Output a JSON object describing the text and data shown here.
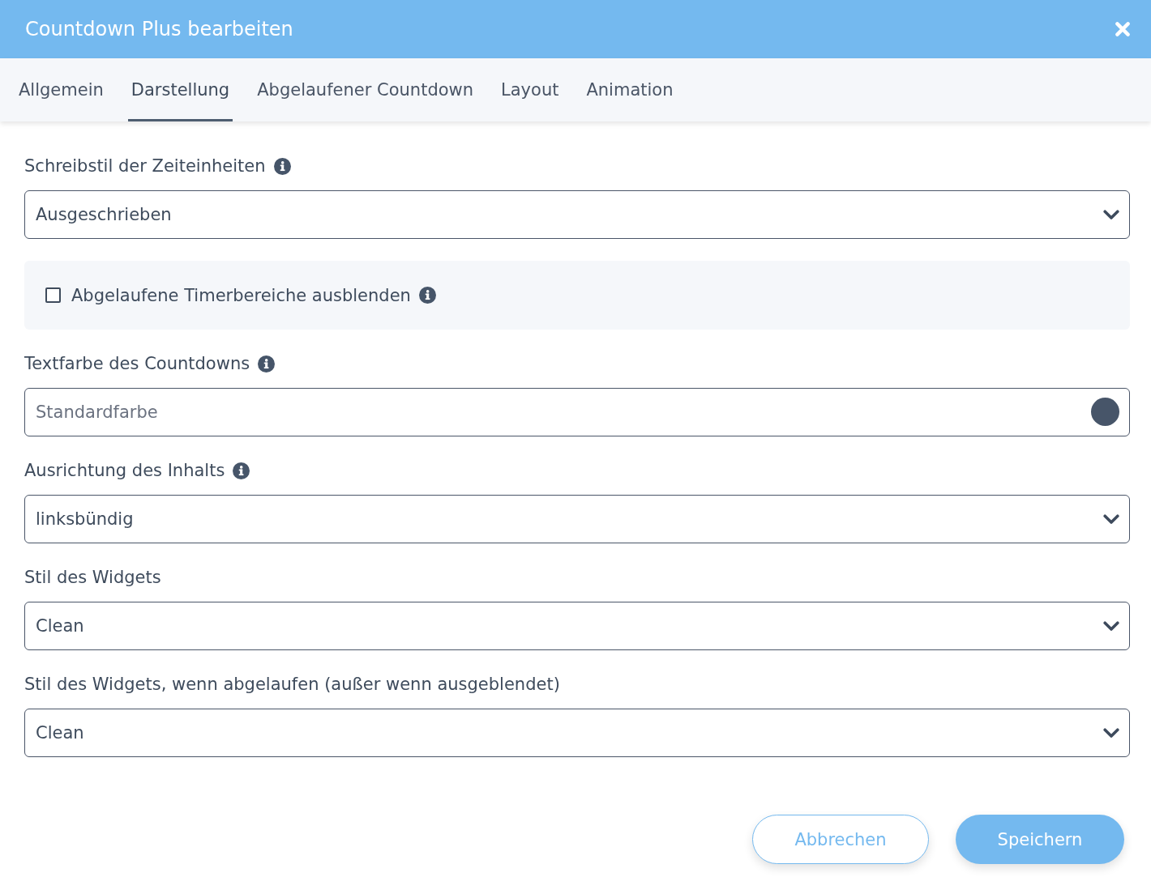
{
  "dialog": {
    "title": "Countdown Plus bearbeiten"
  },
  "tabs": [
    {
      "label": "Allgemein",
      "selected": false
    },
    {
      "label": "Darstellung",
      "selected": true
    },
    {
      "label": "Abgelaufener Countdown",
      "selected": false
    },
    {
      "label": "Layout",
      "selected": false
    },
    {
      "label": "Animation",
      "selected": false
    }
  ],
  "fields": [
    {
      "kind": "select",
      "label": "Schreibstil der Zeiteinheiten",
      "info": true,
      "value": "Ausgeschrieben"
    },
    {
      "kind": "checkbox",
      "label": "Abgelaufene Timerbereiche ausblenden",
      "info": true,
      "checked": false
    },
    {
      "kind": "color",
      "label": "Textfarbe des Countdowns",
      "info": true,
      "placeholder": "Standardfarbe",
      "color": "#475569"
    },
    {
      "kind": "select",
      "label": "Ausrichtung des Inhalts",
      "info": true,
      "value": "linksbündig"
    },
    {
      "kind": "select",
      "label": "Stil des Widgets",
      "info": false,
      "value": "Clean"
    },
    {
      "kind": "select",
      "label": "Stil des Widgets, wenn abgelaufen (außer wenn ausgeblendet)",
      "info": false,
      "value": "Clean"
    }
  ],
  "buttons": [
    {
      "label": "Abbrechen",
      "kind": "secondary"
    },
    {
      "label": "Speichern",
      "kind": "primary"
    }
  ]
}
